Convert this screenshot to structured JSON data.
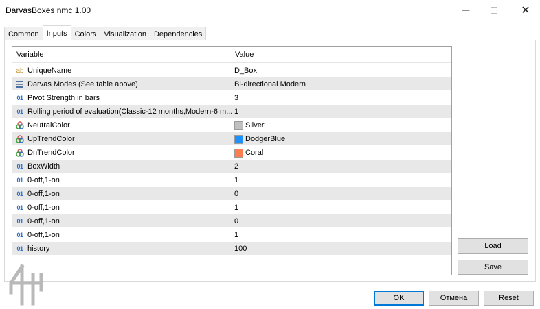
{
  "window": {
    "title": "DarvasBoxes nmc 1.00",
    "minimize_glyph": "—",
    "close_glyph": "✕"
  },
  "tabs": [
    {
      "label": "Common",
      "active": false
    },
    {
      "label": "Inputs",
      "active": true
    },
    {
      "label": "Colors",
      "active": false
    },
    {
      "label": "Visualization",
      "active": false
    },
    {
      "label": "Dependencies",
      "active": false
    }
  ],
  "grid": {
    "headers": {
      "variable": "Variable",
      "value": "Value"
    },
    "rows": [
      {
        "icon": "ab",
        "name": "UniqueName",
        "value": "D_Box"
      },
      {
        "icon": "enum",
        "name": "Darvas Modes (See table above)",
        "value": "Bi-directional Modern"
      },
      {
        "icon": "01",
        "name": "Pivot Strength in bars",
        "value": "3"
      },
      {
        "icon": "01",
        "name": "Rolling period of evaluation(Classic-12 months,Modern-6 m...",
        "value": "1"
      },
      {
        "icon": "color",
        "name": "NeutralColor",
        "value": "Silver",
        "swatch": "#c0c0c0"
      },
      {
        "icon": "color",
        "name": "UpTrendColor",
        "value": "DodgerBlue",
        "swatch": "#1e90ff"
      },
      {
        "icon": "color",
        "name": "DnTrendColor",
        "value": "Coral",
        "swatch": "#ff7f50"
      },
      {
        "icon": "01",
        "name": "BoxWidth",
        "value": "2"
      },
      {
        "icon": "01",
        "name": "0-off,1-on",
        "value": "1"
      },
      {
        "icon": "01",
        "name": "0-off,1-on",
        "value": "0"
      },
      {
        "icon": "01",
        "name": "0-off,1-on",
        "value": "1"
      },
      {
        "icon": "01",
        "name": "0-off,1-on",
        "value": "0"
      },
      {
        "icon": "01",
        "name": "0-off,1-on",
        "value": "1"
      },
      {
        "icon": "01",
        "name": "history",
        "value": "100"
      }
    ]
  },
  "side_buttons": {
    "load": "Load",
    "save": "Save"
  },
  "footer_buttons": {
    "ok": "OK",
    "cancel": "Отмена",
    "reset": "Reset"
  },
  "colors": {
    "ok_border": "#0078d7",
    "int_icon": "#2a6ec8",
    "string_icon": "#c48a1f"
  }
}
